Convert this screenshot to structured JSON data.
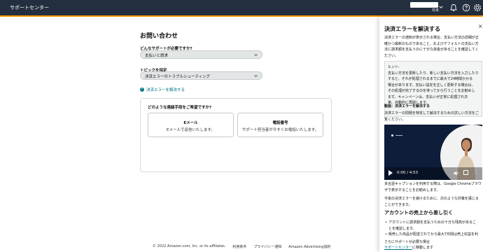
{
  "header": {
    "title": "サポートセンター",
    "breadcrumb_chevron": "›",
    "lang": "日本"
  },
  "main": {
    "page_title": "お問い合わせ",
    "q1_label": "どんなサポートが必要ですか?",
    "q1_value": "支払いと請求",
    "q2_label": "トピックを指定",
    "q2_value": "決済エラーのトラブルシューティング",
    "info_link": "決済エラーを解決する",
    "contact_question": "どのような連絡手段をご希望ですか?",
    "options": [
      {
        "title": "Eメール",
        "desc": "Eメールで返信いたします。"
      },
      {
        "title": "電話番号",
        "desc": "サポート担当者が今すぐお電話いたします。"
      }
    ]
  },
  "footer": {
    "copyright": "© 2022 Amazon.com, Inc. or its affiliates.",
    "links": [
      "利用条件",
      "プライバシー通知",
      "Amazon Advertising協約"
    ]
  },
  "panel": {
    "title": "決済エラーを解決する",
    "close": "×",
    "intro": [
      "決済エラーの通知が表示される場合、支払い方法の詳細が正",
      "確かつ最新のものであること、およびデフォルトの支払い方",
      "法に請求額を支払うのに十分な資金があることを確認してく",
      "ださい。"
    ],
    "hint_title": "ヒント:",
    "hint_lines": [
      "支払い方法を更新したり、新しい支払い方法を入力したり",
      "すると、それが処理されるまでに最大で24時間かかる",
      "場合があります。支払い設定を正しく更新する場合は、",
      "その処理が完了するのを待ってから行うことをお勧めし",
      "ます。キャンペーンは、支払いが正常に処理され次",
      "第、自動的に再開します。"
    ],
    "video_label": "動画：決済エラーを解決する",
    "video_desc": [
      "決済エラーの問題を特定して解決するための詳しい方法をご",
      "覧ください。"
    ],
    "video_time": "0:00 / 4:53",
    "caption_text": [
      "多言語キャプションを利用する際は、Google Chromeブラウ",
      "ザで表示することをお勧めします。"
    ],
    "future_text": [
      "今後の決済エラーを避けるために、次のような対策を講じる",
      "ことができます。"
    ],
    "section_title": "アカウントの売上から差し引く",
    "bullets": [
      [
        "アカウントに請求額を支払うための十分な残高があるこ",
        "とを確認します。"
      ],
      [
        "販売した商品が配送されてから最大7日間は売上収益を利"
      ]
    ],
    "more_help": "さらにサポートが必要な場合",
    "support_link": "サポートセンター",
    "support_suffix": "に移動します"
  }
}
